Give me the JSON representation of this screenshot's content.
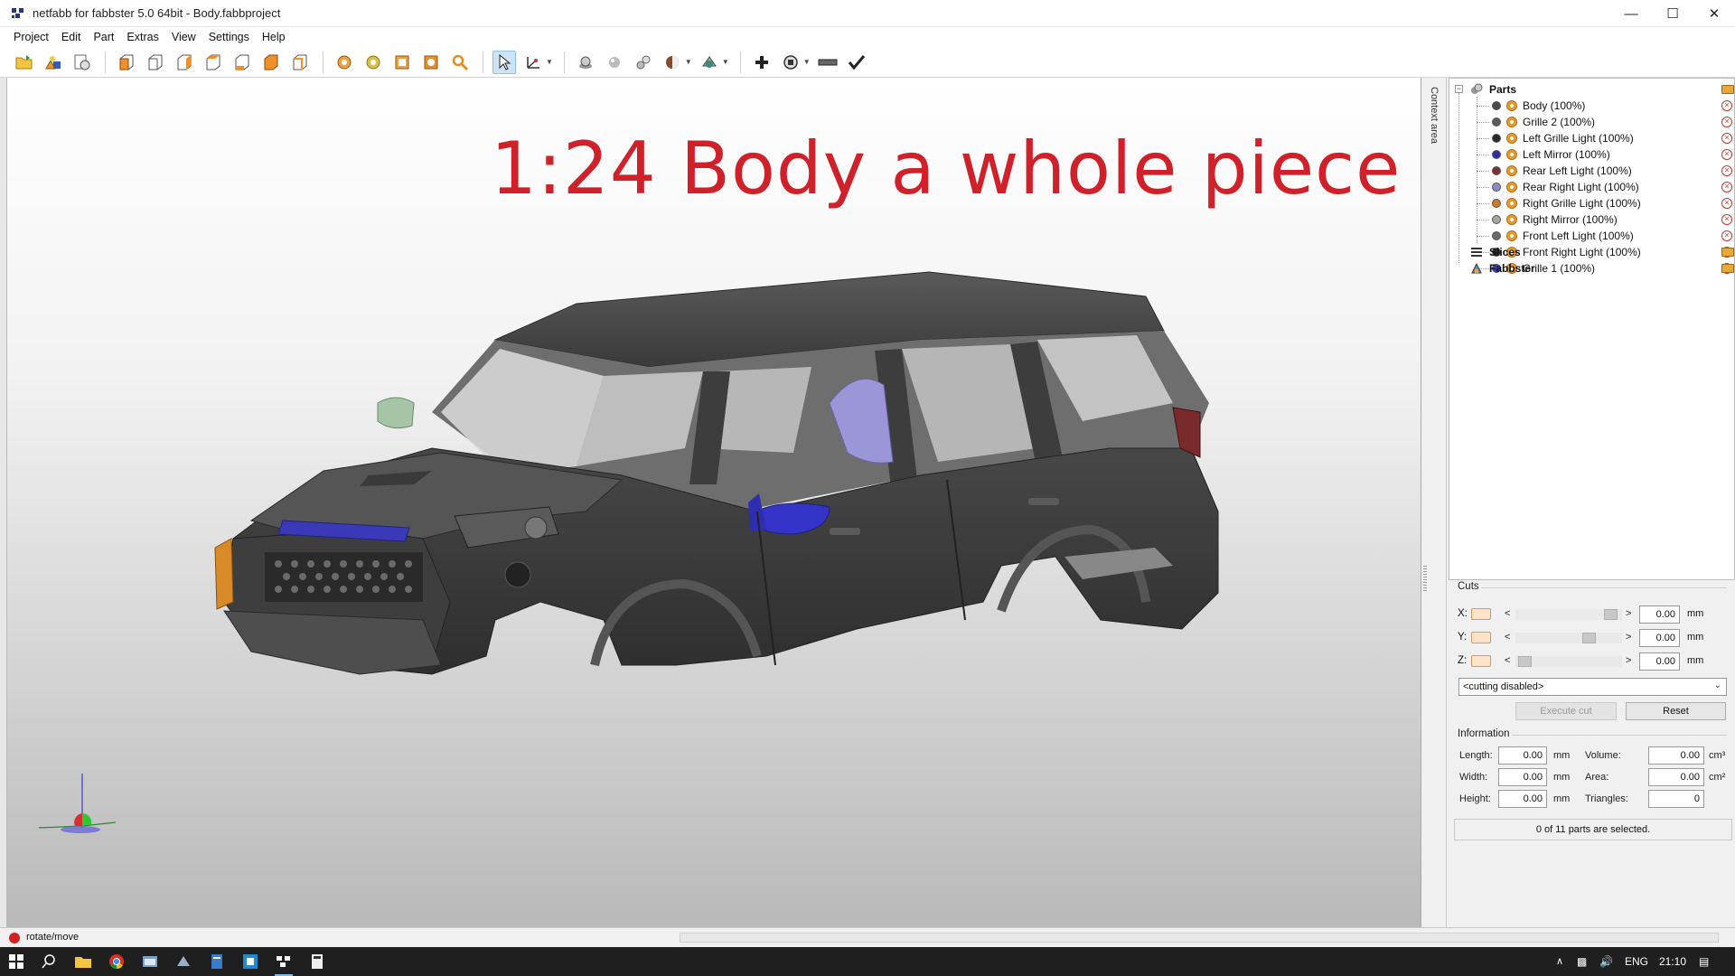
{
  "window": {
    "title": "netfabb for fabbster 5.0 64bit - Body.fabbproject"
  },
  "menu": [
    "Project",
    "Edit",
    "Part",
    "Extras",
    "View",
    "Settings",
    "Help"
  ],
  "viewport": {
    "overlay_title": "1:24 Body a whole piece"
  },
  "context_tab": {
    "label": "Context area"
  },
  "tree": {
    "parts_label": "Parts",
    "parts": [
      {
        "label": "Body (100%)",
        "color": "#4a4a4a"
      },
      {
        "label": "Grille 2 (100%)",
        "color": "#5a5a5a"
      },
      {
        "label": "Left Grille Light (100%)",
        "color": "#2a2a2a"
      },
      {
        "label": "Left Mirror (100%)",
        "color": "#2e2ea8"
      },
      {
        "label": "Rear Left Light (100%)",
        "color": "#7a3030"
      },
      {
        "label": "Rear Right Light (100%)",
        "color": "#8a8ac8"
      },
      {
        "label": "Right Grille Light (100%)",
        "color": "#d07a20"
      },
      {
        "label": "Right Mirror (100%)",
        "color": "#a0a8a0"
      },
      {
        "label": "Front Left Light (100%)",
        "color": "#6a6a6a"
      },
      {
        "label": "Front Right Light (100%)",
        "color": "#2a2a2a"
      },
      {
        "label": "Grille 1 (100%)",
        "color": "#3a3ab0"
      }
    ],
    "slices_label": "Slices",
    "fabbster_label": "Fabbster"
  },
  "cuts": {
    "title": "Cuts",
    "rows": [
      {
        "axis": "X:",
        "lt": "<",
        "gt": ">",
        "value": "0.00",
        "unit": "mm",
        "thumb": 0.95
      },
      {
        "axis": "Y:",
        "lt": "<",
        "gt": ">",
        "value": "0.00",
        "unit": "mm",
        "thumb": 0.72
      },
      {
        "axis": "Z:",
        "lt": "<",
        "gt": ">",
        "value": "0.00",
        "unit": "mm",
        "thumb": 0.03
      }
    ],
    "mode": "<cutting disabled>",
    "execute_label": "Execute cut",
    "reset_label": "Reset"
  },
  "info": {
    "title": "Information",
    "length_label": "Length:",
    "length_value": "0.00",
    "length_unit": "mm",
    "width_label": "Width:",
    "width_value": "0.00",
    "width_unit": "mm",
    "height_label": "Height:",
    "height_value": "0.00",
    "height_unit": "mm",
    "volume_label": "Volume:",
    "volume_value": "0.00",
    "volume_unit": "cm³",
    "area_label": "Area:",
    "area_value": "0.00",
    "area_unit": "cm²",
    "triangles_label": "Triangles:",
    "triangles_value": "0"
  },
  "selection_status": "0 of 11 parts are selected.",
  "statusbar": {
    "text": "rotate/move"
  },
  "taskbar": {
    "lang": "ENG",
    "time": "21:10"
  }
}
